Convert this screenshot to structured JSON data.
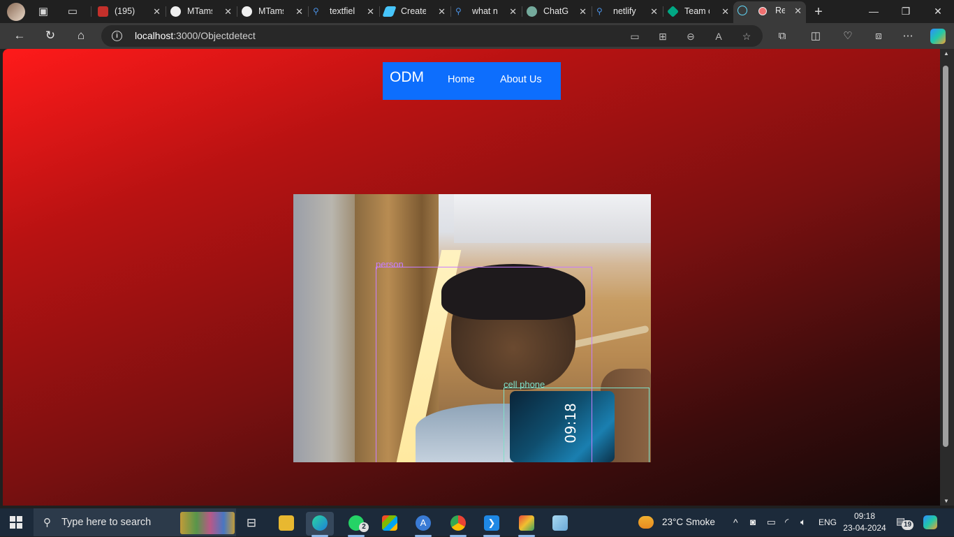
{
  "browser": {
    "tabs": [
      {
        "title": "(195)",
        "favicon": "youtube-icon",
        "color": "#ff2d2d"
      },
      {
        "title": "MTams",
        "favicon": "github-icon",
        "color": "#ffffff"
      },
      {
        "title": "MTams",
        "favicon": "github-icon",
        "color": "#ffffff"
      },
      {
        "title": "textfiel",
        "favicon": "search-icon",
        "color": "#4a90e2"
      },
      {
        "title": "Create",
        "favicon": "flutter-icon",
        "color": "#47c5fb"
      },
      {
        "title": "what n",
        "favicon": "search-icon",
        "color": "#4a90e2"
      },
      {
        "title": "ChatGP",
        "favicon": "chatgpt-icon",
        "color": "#74aa9c"
      },
      {
        "title": "netlify",
        "favicon": "search-icon",
        "color": "#4a90e2"
      },
      {
        "title": "Team c",
        "favicon": "team-icon",
        "color": "#00a884"
      },
      {
        "title": "Re",
        "favicon": "react-icon",
        "color": "#61dafb"
      }
    ],
    "address": {
      "host": "localhost",
      "path": ":3000/Objectdetect"
    }
  },
  "page": {
    "navbar": {
      "brand": "ODM",
      "links": [
        "Home",
        "About Us"
      ],
      "background": "#0d6efd"
    },
    "camera": {
      "phone_time": "09:18",
      "detections": [
        {
          "label": "person",
          "color": "#c77dff"
        },
        {
          "label": "cell phone",
          "color": "#7fe0c8"
        }
      ]
    }
  },
  "taskbar": {
    "search_placeholder": "Type here to search",
    "whatsapp_badge": "2",
    "weather": "23°C  Smoke",
    "language": "ENG",
    "time": "09:18",
    "date": "23-04-2024",
    "notification_count": "19"
  }
}
